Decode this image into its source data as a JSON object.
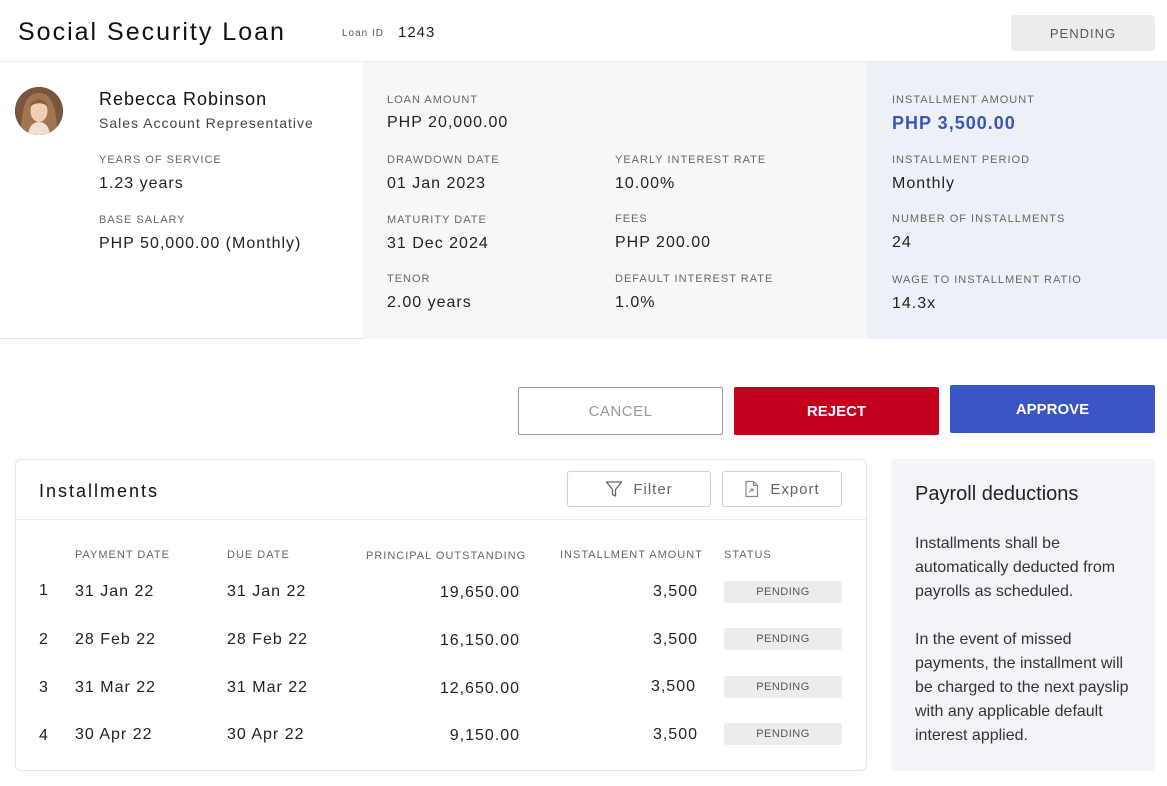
{
  "header": {
    "title": "Social Security Loan",
    "loan_id_label": "Loan ID",
    "loan_id": "1243",
    "status": "PENDING"
  },
  "employee": {
    "name": "Rebecca Robinson",
    "role": "Sales Account Representative",
    "years_of_service_label": "YEARS OF SERVICE",
    "years_of_service": "1.23 years",
    "base_salary_label": "BASE SALARY",
    "base_salary": "PHP 50,000.00 (Monthly)"
  },
  "loan": {
    "loan_amount_label": "LOAN AMOUNT",
    "loan_amount": "PHP 20,000.00",
    "drawdown_date_label": "DRAWDOWN DATE",
    "drawdown_date": "01 Jan 2023",
    "maturity_date_label": "MATURITY DATE",
    "maturity_date": "31 Dec 2024",
    "tenor_label": "TENOR",
    "tenor": "2.00 years",
    "yearly_interest_label": "YEARLY INTEREST RATE",
    "yearly_interest": "10.00%",
    "fees_label": "FEES",
    "fees": "PHP 200.00",
    "default_interest_label": "DEFAULT INTEREST RATE",
    "default_interest": "1.0%"
  },
  "installment": {
    "amount_label": "INSTALLMENT AMOUNT",
    "amount": "PHP 3,500.00",
    "period_label": "INSTALLMENT PERIOD",
    "period": "Monthly",
    "count_label": "NUMBER OF INSTALLMENTS",
    "count": "24",
    "ratio_label": "WAGE TO INSTALLMENT RATIO",
    "ratio": "14.3x"
  },
  "actions": {
    "cancel": "CANCEL",
    "reject": "REJECT",
    "approve": "APPROVE"
  },
  "installments_table": {
    "title": "Installments",
    "filter_label": "Filter",
    "export_label": "Export",
    "columns": [
      "PAYMENT DATE",
      "DUE DATE",
      "PRINCIPAL OUTSTANDING",
      "INSTALLMENT AMOUNT",
      "STATUS"
    ],
    "rows": [
      {
        "num": "1",
        "payment_date": "31 Jan 22",
        "due_date": "31 Jan 22",
        "principal": "19,650.00",
        "amount": "3,500",
        "status": "PENDING"
      },
      {
        "num": "2",
        "payment_date": "28 Feb 22",
        "due_date": "28 Feb 22",
        "principal": "16,150.00",
        "amount": "3,500",
        "status": "PENDING"
      },
      {
        "num": "3",
        "payment_date": "31 Mar 22",
        "due_date": "31 Mar 22",
        "principal": "12,650.00",
        "amount": "3,500",
        "status": "PENDING"
      },
      {
        "num": "4",
        "payment_date": "30 Apr 22",
        "due_date": "30 Apr 22",
        "principal": "9,150.00",
        "amount": "3,500",
        "status": "PENDING"
      }
    ]
  },
  "payroll": {
    "title": "Payroll deductions",
    "paragraph1": "Installments shall be automatically deducted from payrolls as scheduled.",
    "paragraph2": "In the event of missed payments, the installment will be charged to the next payslip with any applicable default interest applied."
  },
  "colors": {
    "reject": "#c4001f",
    "approve": "#3a55c4",
    "accent_text": "#3a55b8"
  }
}
